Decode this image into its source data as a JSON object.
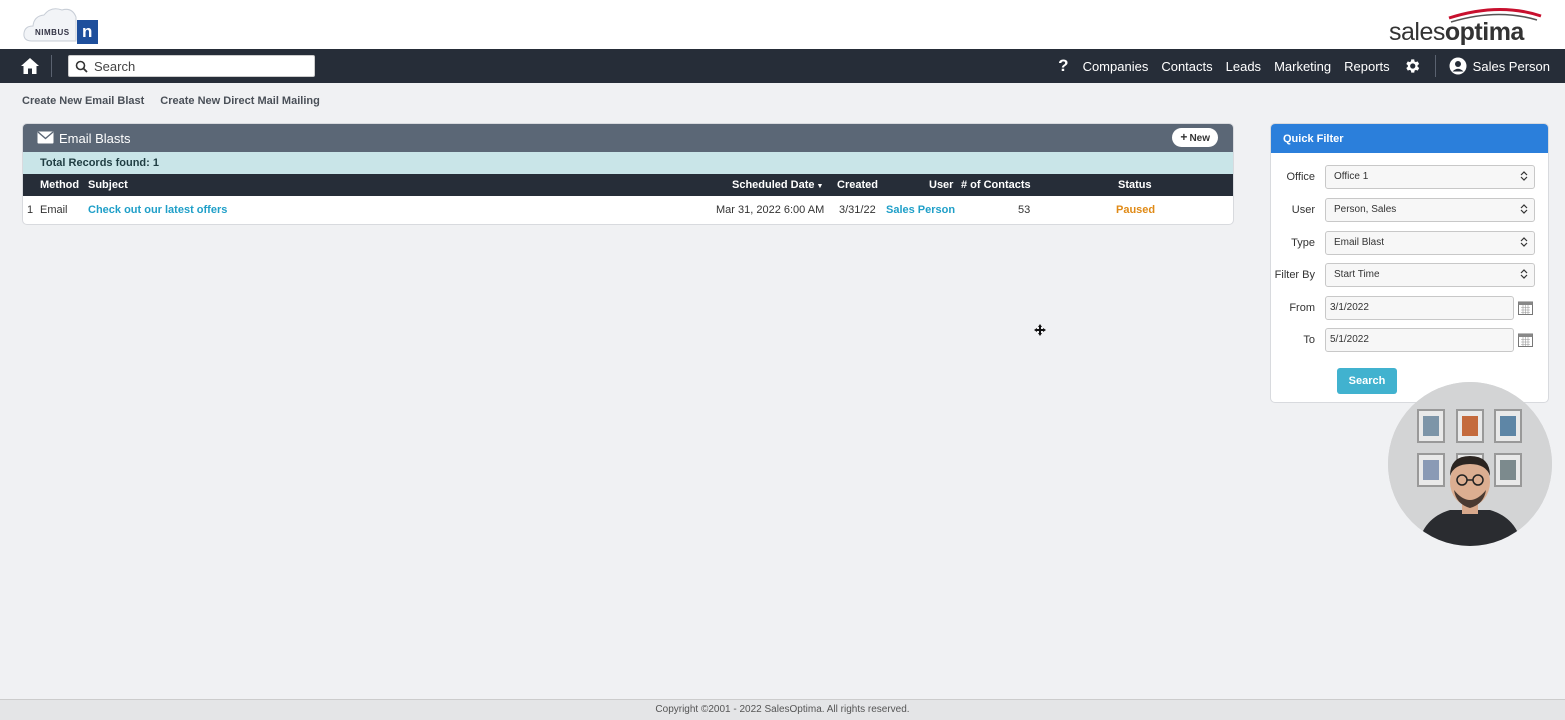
{
  "brand": {
    "nimbus_text": "NIMBUS",
    "nimbus_letter": "n",
    "so_left": "sales",
    "so_right": "optima",
    "accent": "#c8102e"
  },
  "nav": {
    "search_placeholder": "Search",
    "help": "?",
    "links": [
      "Companies",
      "Contacts",
      "Leads",
      "Marketing",
      "Reports"
    ],
    "user": "Sales Person"
  },
  "actions": {
    "email_blast": "Create New Email Blast",
    "direct_mail": "Create New Direct Mail Mailing"
  },
  "panel": {
    "title": "Email Blasts",
    "new_label": "New",
    "total": "Total Records found: 1",
    "columns": {
      "method": "Method",
      "subject": "Subject",
      "scheduled": "Scheduled Date",
      "created": "Created",
      "user": "User",
      "contacts": "# of Contacts",
      "status": "Status"
    },
    "rows": [
      {
        "index": "1",
        "method": "Email",
        "subject": "Check out our latest offers",
        "scheduled": "Mar 31, 2022 6:00 AM",
        "created": "3/31/22",
        "user": "Sales Person",
        "contacts": "53",
        "status": "Paused"
      }
    ]
  },
  "quick_filter": {
    "title": "Quick Filter",
    "office": {
      "label": "Office",
      "value": "Office 1"
    },
    "user": {
      "label": "User",
      "value": "Person, Sales"
    },
    "type": {
      "label": "Type",
      "value": "Email Blast"
    },
    "filter_by": {
      "label": "Filter By",
      "value": "Start Time"
    },
    "from": {
      "label": "From",
      "value": "3/1/2022"
    },
    "to": {
      "label": "To",
      "value": "5/1/2022"
    },
    "search_label": "Search"
  },
  "footer": "Copyright ©2001 - 2022 SalesOptima. All rights reserved.",
  "colors": {
    "navbar": "#262d38",
    "panel_header": "#5b6776",
    "total_bar": "#c9e5e8",
    "filter_header": "#2b7fdb",
    "link": "#1f9fc8",
    "paused": "#e08a16",
    "search_button": "#41b2cf"
  }
}
